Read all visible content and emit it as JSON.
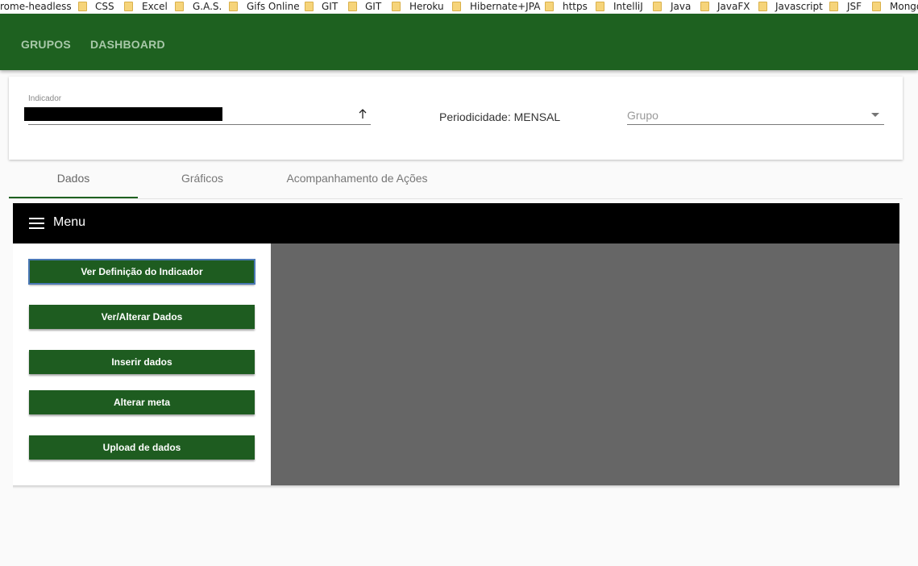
{
  "bookmarks": [
    {
      "label": "rome-headless"
    },
    {
      "label": "CSS"
    },
    {
      "label": "Excel"
    },
    {
      "label": "G.A.S."
    },
    {
      "label": "Gifs Online"
    },
    {
      "label": "GIT"
    },
    {
      "label": "GIT"
    },
    {
      "label": "Heroku"
    },
    {
      "label": "Hibernate+JPA"
    },
    {
      "label": "https"
    },
    {
      "label": "IntelliJ"
    },
    {
      "label": "Java"
    },
    {
      "label": "JavaFX"
    },
    {
      "label": "Javascript"
    },
    {
      "label": "JSF"
    },
    {
      "label": "Mongo"
    }
  ],
  "toolbar": {
    "nav": [
      "GRUPOS",
      "DASHBOARD"
    ],
    "color": "#1e6120"
  },
  "filter": {
    "indicador_label": "Indicador",
    "periodicidade": "Periodicidade: MENSAL",
    "grupo_placeholder": "Grupo"
  },
  "tabs": [
    {
      "label": "Dados",
      "active": true
    },
    {
      "label": "Gráficos",
      "active": false
    },
    {
      "label": "Acompanhamento de Ações",
      "active": false
    }
  ],
  "menu": {
    "title": "Menu",
    "buttons": [
      "Ver Definição do Indicador",
      "Ver/Alterar Dados",
      "Inserir dados",
      "Alterar meta",
      "Upload de dados"
    ]
  }
}
